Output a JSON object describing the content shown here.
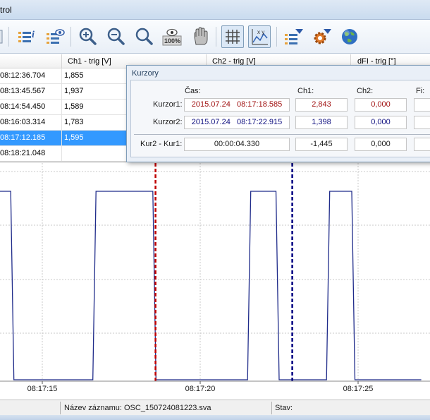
{
  "window": {
    "title": "trol"
  },
  "toolbar": {
    "buttons": [
      {
        "icon": "list-info-icon"
      },
      {
        "icon": "list-view-icon"
      },
      {
        "icon": "zoom-in-icon"
      },
      {
        "icon": "zoom-out-icon"
      },
      {
        "icon": "zoom-fit-icon"
      },
      {
        "icon": "zoom-100-icon",
        "label": "100%"
      },
      {
        "icon": "pan-hand-icon"
      },
      {
        "icon": "grid-icon"
      },
      {
        "icon": "xy-chart-icon",
        "label": "x y"
      },
      {
        "icon": "list-filter-icon"
      },
      {
        "icon": "settings-gear-icon"
      },
      {
        "icon": "globe-icon"
      }
    ]
  },
  "table": {
    "columns": [
      "Ch1 - trig [V]",
      "Ch2 - trig [V]",
      "dFI - trig [°]"
    ],
    "rows": [
      {
        "time": "08:12:36.704",
        "ch1": "1,855",
        "selected": false
      },
      {
        "time": "08:13:45.567",
        "ch1": "1,937",
        "selected": false
      },
      {
        "time": "08:14:54.450",
        "ch1": "1,589",
        "selected": false
      },
      {
        "time": "08:16:03.314",
        "ch1": "1,783",
        "selected": false
      },
      {
        "time": "08:17:12.185",
        "ch1": "1,595",
        "selected": true
      },
      {
        "time": "08:18:21.048",
        "ch1": "",
        "selected": false
      }
    ]
  },
  "kurzory": {
    "title": "Kurzory",
    "headers": {
      "cas": "Čas:",
      "ch1": "Ch1:",
      "ch2": "Ch2:",
      "fi": "Fi:"
    },
    "rows": [
      {
        "label": "Kurzor1:",
        "date": "2015.07.24",
        "time": "08:17:18.585",
        "ch1": "2,843",
        "ch2": "0,000"
      },
      {
        "label": "Kurzor2:",
        "date": "2015.07.24",
        "time": "08:17:22.915",
        "ch1": "1,398",
        "ch2": "0,000"
      }
    ],
    "diff": {
      "label": "Kur2 - Kur1:",
      "time": "00:00:04.330",
      "ch1": "-1,445",
      "ch2": "0,000"
    }
  },
  "chart_data": {
    "type": "line",
    "x_ticks": [
      "08:17:15",
      "08:17:20",
      "08:17:25"
    ],
    "cursors": [
      {
        "name": "Kurzor1",
        "time": "08:17:18.585",
        "color": "#c00000"
      },
      {
        "name": "Kurzor2",
        "time": "08:17:22.915",
        "color": "#000080"
      }
    ],
    "series": [
      {
        "color": "#1f2b8a",
        "x": [
          "08:17:13.25",
          "08:17:13.35",
          "08:17:14.0",
          "08:17:14.1",
          "08:17:16.6",
          "08:17:16.7",
          "08:17:18.5",
          "08:17:18.6",
          "08:17:21.5",
          "08:17:21.6",
          "08:17:22.4",
          "08:17:22.5",
          "08:17:24.0",
          "08:17:24.1",
          "08:17:24.8",
          "08:17:24.9",
          "08:17:26.5",
          "08:17:26.6",
          "08:17:27.0"
        ],
        "y": [
          2.84,
          2.84,
          2.84,
          0.0,
          0.0,
          2.84,
          2.84,
          0.0,
          0.0,
          2.84,
          2.84,
          0.0,
          0.0,
          2.84,
          2.84,
          0.0,
          0.0,
          0.0,
          0.0
        ]
      }
    ]
  },
  "statusbar": {
    "record": "Název záznamu: OSC_150724081223.sva",
    "state": "Stav:"
  }
}
